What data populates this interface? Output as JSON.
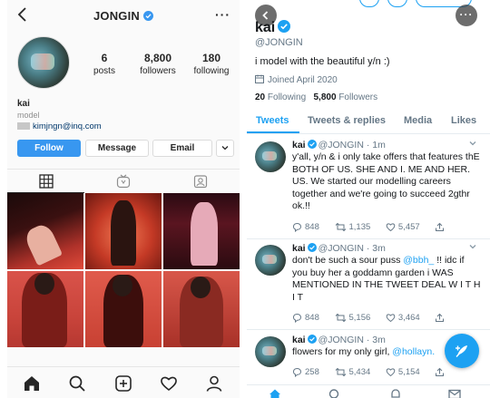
{
  "instagram": {
    "username": "JONGIN",
    "stats": [
      {
        "num": "6",
        "label": "posts"
      },
      {
        "num": "8,800",
        "label": "followers"
      },
      {
        "num": "180",
        "label": "following"
      }
    ],
    "bio_name": "kai",
    "bio_category": "model",
    "bio_email": "kimjngn@inq.com",
    "buttons": {
      "follow": "Follow",
      "message": "Message",
      "email": "Email"
    },
    "colors": {
      "follow_blue": "#3897f0"
    }
  },
  "twitter": {
    "name": "kai",
    "handle": "@JONGIN",
    "bio": "i model with the beautiful y/n :)",
    "joined": "Joined April 2020",
    "following_count": "20",
    "following_label": "Following",
    "followers_count": "5,800",
    "followers_label": "Followers",
    "tabs": [
      "Tweets",
      "Tweets & replies",
      "Media",
      "Likes"
    ],
    "tweets": [
      {
        "name": "kai",
        "handle": "@JONGIN",
        "time": "· 1m",
        "text": "y'all, y/n & i only take offers that features thE BOTH OF US. SHE AND I. ME AND HER. US. We started our modelling careers together and we're going to succeed 2gthr ok.!!",
        "replies": "848",
        "retweets": "1,135",
        "likes": "5,457"
      },
      {
        "name": "kai",
        "handle": "@JONGIN",
        "time": "· 3m",
        "text_before": "don't be such a sour puss ",
        "mention": "@bbh_",
        "text_after": " !! idc if you buy her a goddamn garden i WAS MENTIONED IN THE TWEET DEAL W I T H I T",
        "replies": "848",
        "retweets": "5,156",
        "likes": "3,464"
      },
      {
        "name": "kai",
        "handle": "@JONGIN",
        "time": "· 3m",
        "text_before": "flowers for my only girl, ",
        "mention": "@hollayn.",
        "replies": "258",
        "retweets": "5,434",
        "likes": "5,154"
      }
    ],
    "colors": {
      "accent": "#1da1f2"
    }
  }
}
